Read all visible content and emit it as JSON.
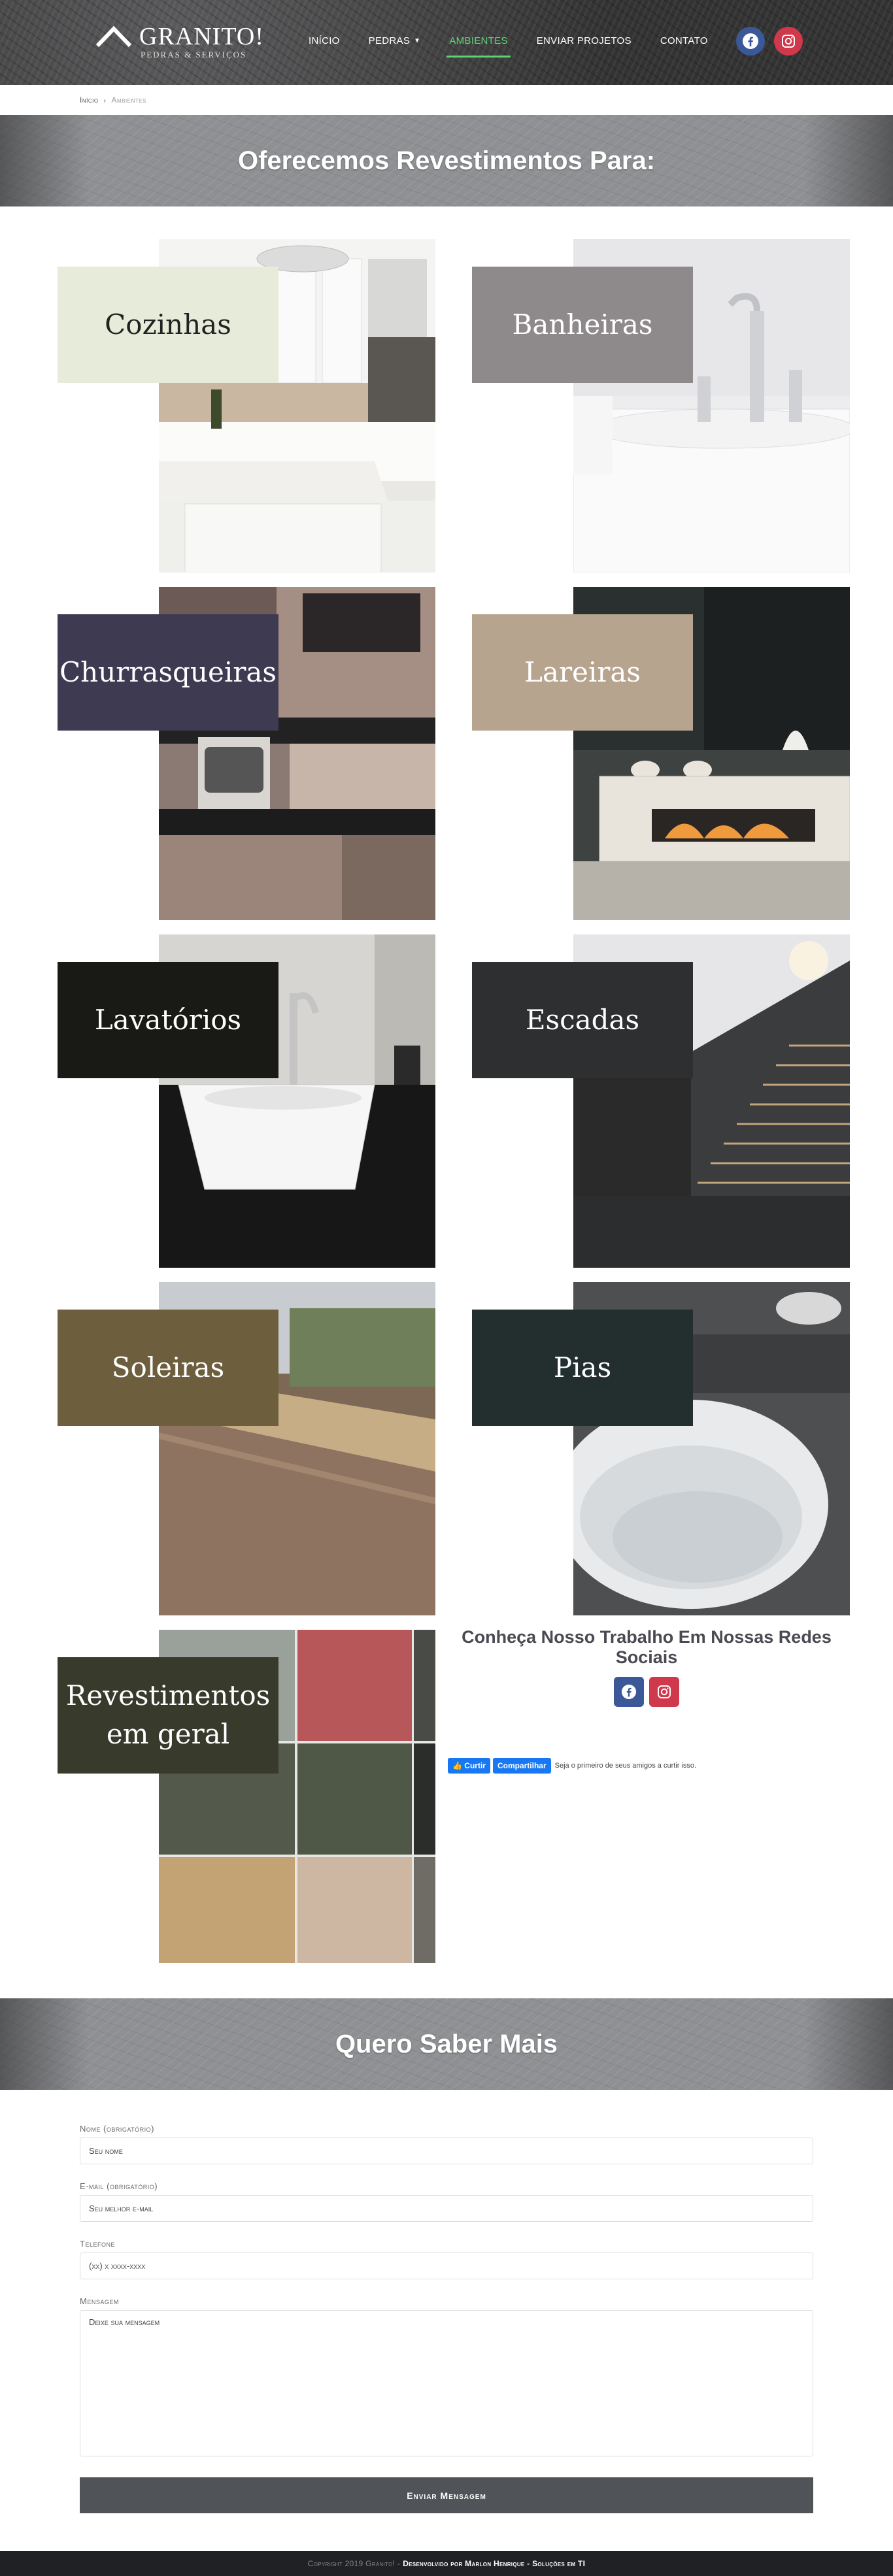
{
  "header": {
    "logo_name": "GRANITO!",
    "logo_sub": "PEDRAS & SERVIÇOS",
    "nav": [
      {
        "label": "Início",
        "active": false
      },
      {
        "label": "Pedras",
        "active": false,
        "caret": true
      },
      {
        "label": "Ambientes",
        "active": true
      },
      {
        "label": "Enviar Projetos",
        "active": false
      },
      {
        "label": "Contato",
        "active": false
      }
    ],
    "accent_color": "#5fd177",
    "social": [
      {
        "icon": "facebook-icon",
        "color": "#3b5998"
      },
      {
        "icon": "instagram-icon",
        "color": "#d0384c"
      }
    ]
  },
  "breadcrumb": {
    "home": "Início",
    "separator": "›",
    "current": "Ambientes"
  },
  "banner_title": "Oferecemos Revestimentos Para:",
  "cards": [
    {
      "label": "Cozinhas",
      "label_bg": "#e7ecda",
      "photo": "kitchen"
    },
    {
      "label": "Banheiras",
      "label_bg": "#8e898a",
      "photo": "bathtub"
    },
    {
      "label": "Churrasqueiras",
      "label_bg": "#3e3a52",
      "photo": "grill"
    },
    {
      "label": "Lareiras",
      "label_bg": "#b7a48f",
      "photo": "fireplace"
    },
    {
      "label": "Lavatórios",
      "label_bg": "#191a16",
      "photo": "washbasin"
    },
    {
      "label": "Escadas",
      "label_bg": "#2d2f30",
      "photo": "stairs"
    },
    {
      "label": "Soleiras",
      "label_bg": "#6d5e3e",
      "photo": "sill"
    },
    {
      "label": "Pias",
      "label_bg": "#232e2f",
      "photo": "sink"
    },
    {
      "label": "Revestimentos em geral",
      "label_bg": "#383a2c",
      "photo": "granite-samples"
    }
  ],
  "social_panel": {
    "title": "Conheça Nosso Trabalho Em Nossas Redes Sociais",
    "like_label": "Curtir",
    "share_label": "Compartilhar",
    "note": "Seja o primeiro de seus amigos a curtir isso."
  },
  "contact_banner_title": "Quero Saber Mais",
  "form": {
    "name_label": "Nome (obrigatório)",
    "name_placeholder": "Seu nome",
    "email_label": "E-mail (obrigatório)",
    "email_placeholder": "Seu melhor e-mail",
    "phone_label": "Telefone",
    "phone_placeholder": "(xx) x xxxx-xxxx",
    "message_label": "Mensagem",
    "message_placeholder": "Deixe sua mensagem",
    "submit_label": "Enviar Mensagem"
  },
  "footer": {
    "copyright": "Copyright 2019 Granito! -",
    "developer": "Desenvolvido por Marlon Henrique - Soluções em TI"
  }
}
